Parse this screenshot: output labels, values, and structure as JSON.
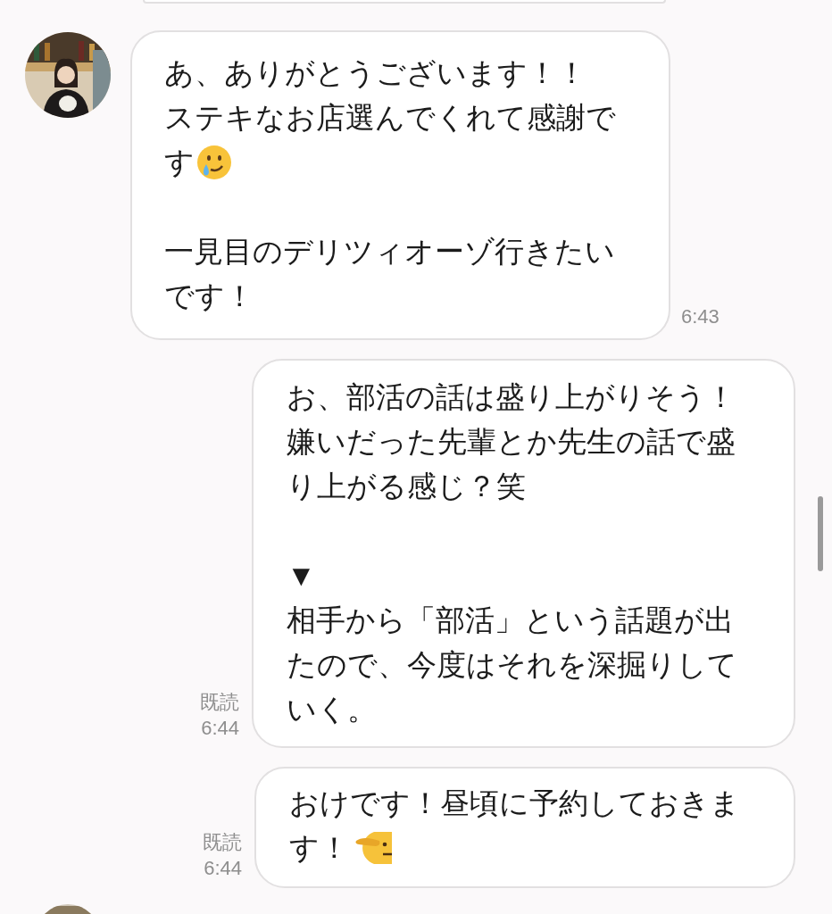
{
  "messages": [
    {
      "kind": "received",
      "lines": [
        {
          "kind": "text",
          "text": "あ、ありがとうございます！！"
        },
        {
          "kind": "text",
          "text": "ステキなお店選んでくれて感謝で"
        },
        {
          "kind": "tearsmile",
          "text": "す"
        },
        {
          "kind": "blank"
        },
        {
          "kind": "text",
          "text": "一見目のデリツィオーゾ行きたい"
        },
        {
          "kind": "text",
          "text": "です！"
        }
      ],
      "time": "6:43"
    },
    {
      "kind": "sent",
      "lines": [
        {
          "kind": "text",
          "text": "お、部活の話は盛り上がりそう！"
        },
        {
          "kind": "text",
          "text": "嫌いだった先輩とか先生の話で盛"
        },
        {
          "kind": "text",
          "text": "り上がる感じ？笑"
        },
        {
          "kind": "blank"
        },
        {
          "kind": "text",
          "text": "▼"
        },
        {
          "kind": "text",
          "text": "相手から「部活」という話題が出"
        },
        {
          "kind": "text",
          "text": "たので、今度はそれを深掘りして"
        },
        {
          "kind": "text",
          "text": "いく。"
        }
      ],
      "read": "既読",
      "time": "6:44"
    },
    {
      "kind": "sent",
      "lines": [
        {
          "kind": "text",
          "text": "おけです！昼頃に予約しておきま"
        },
        {
          "kind": "pointface",
          "text": "す！"
        }
      ],
      "read": "既読",
      "time": "6:44"
    }
  ]
}
